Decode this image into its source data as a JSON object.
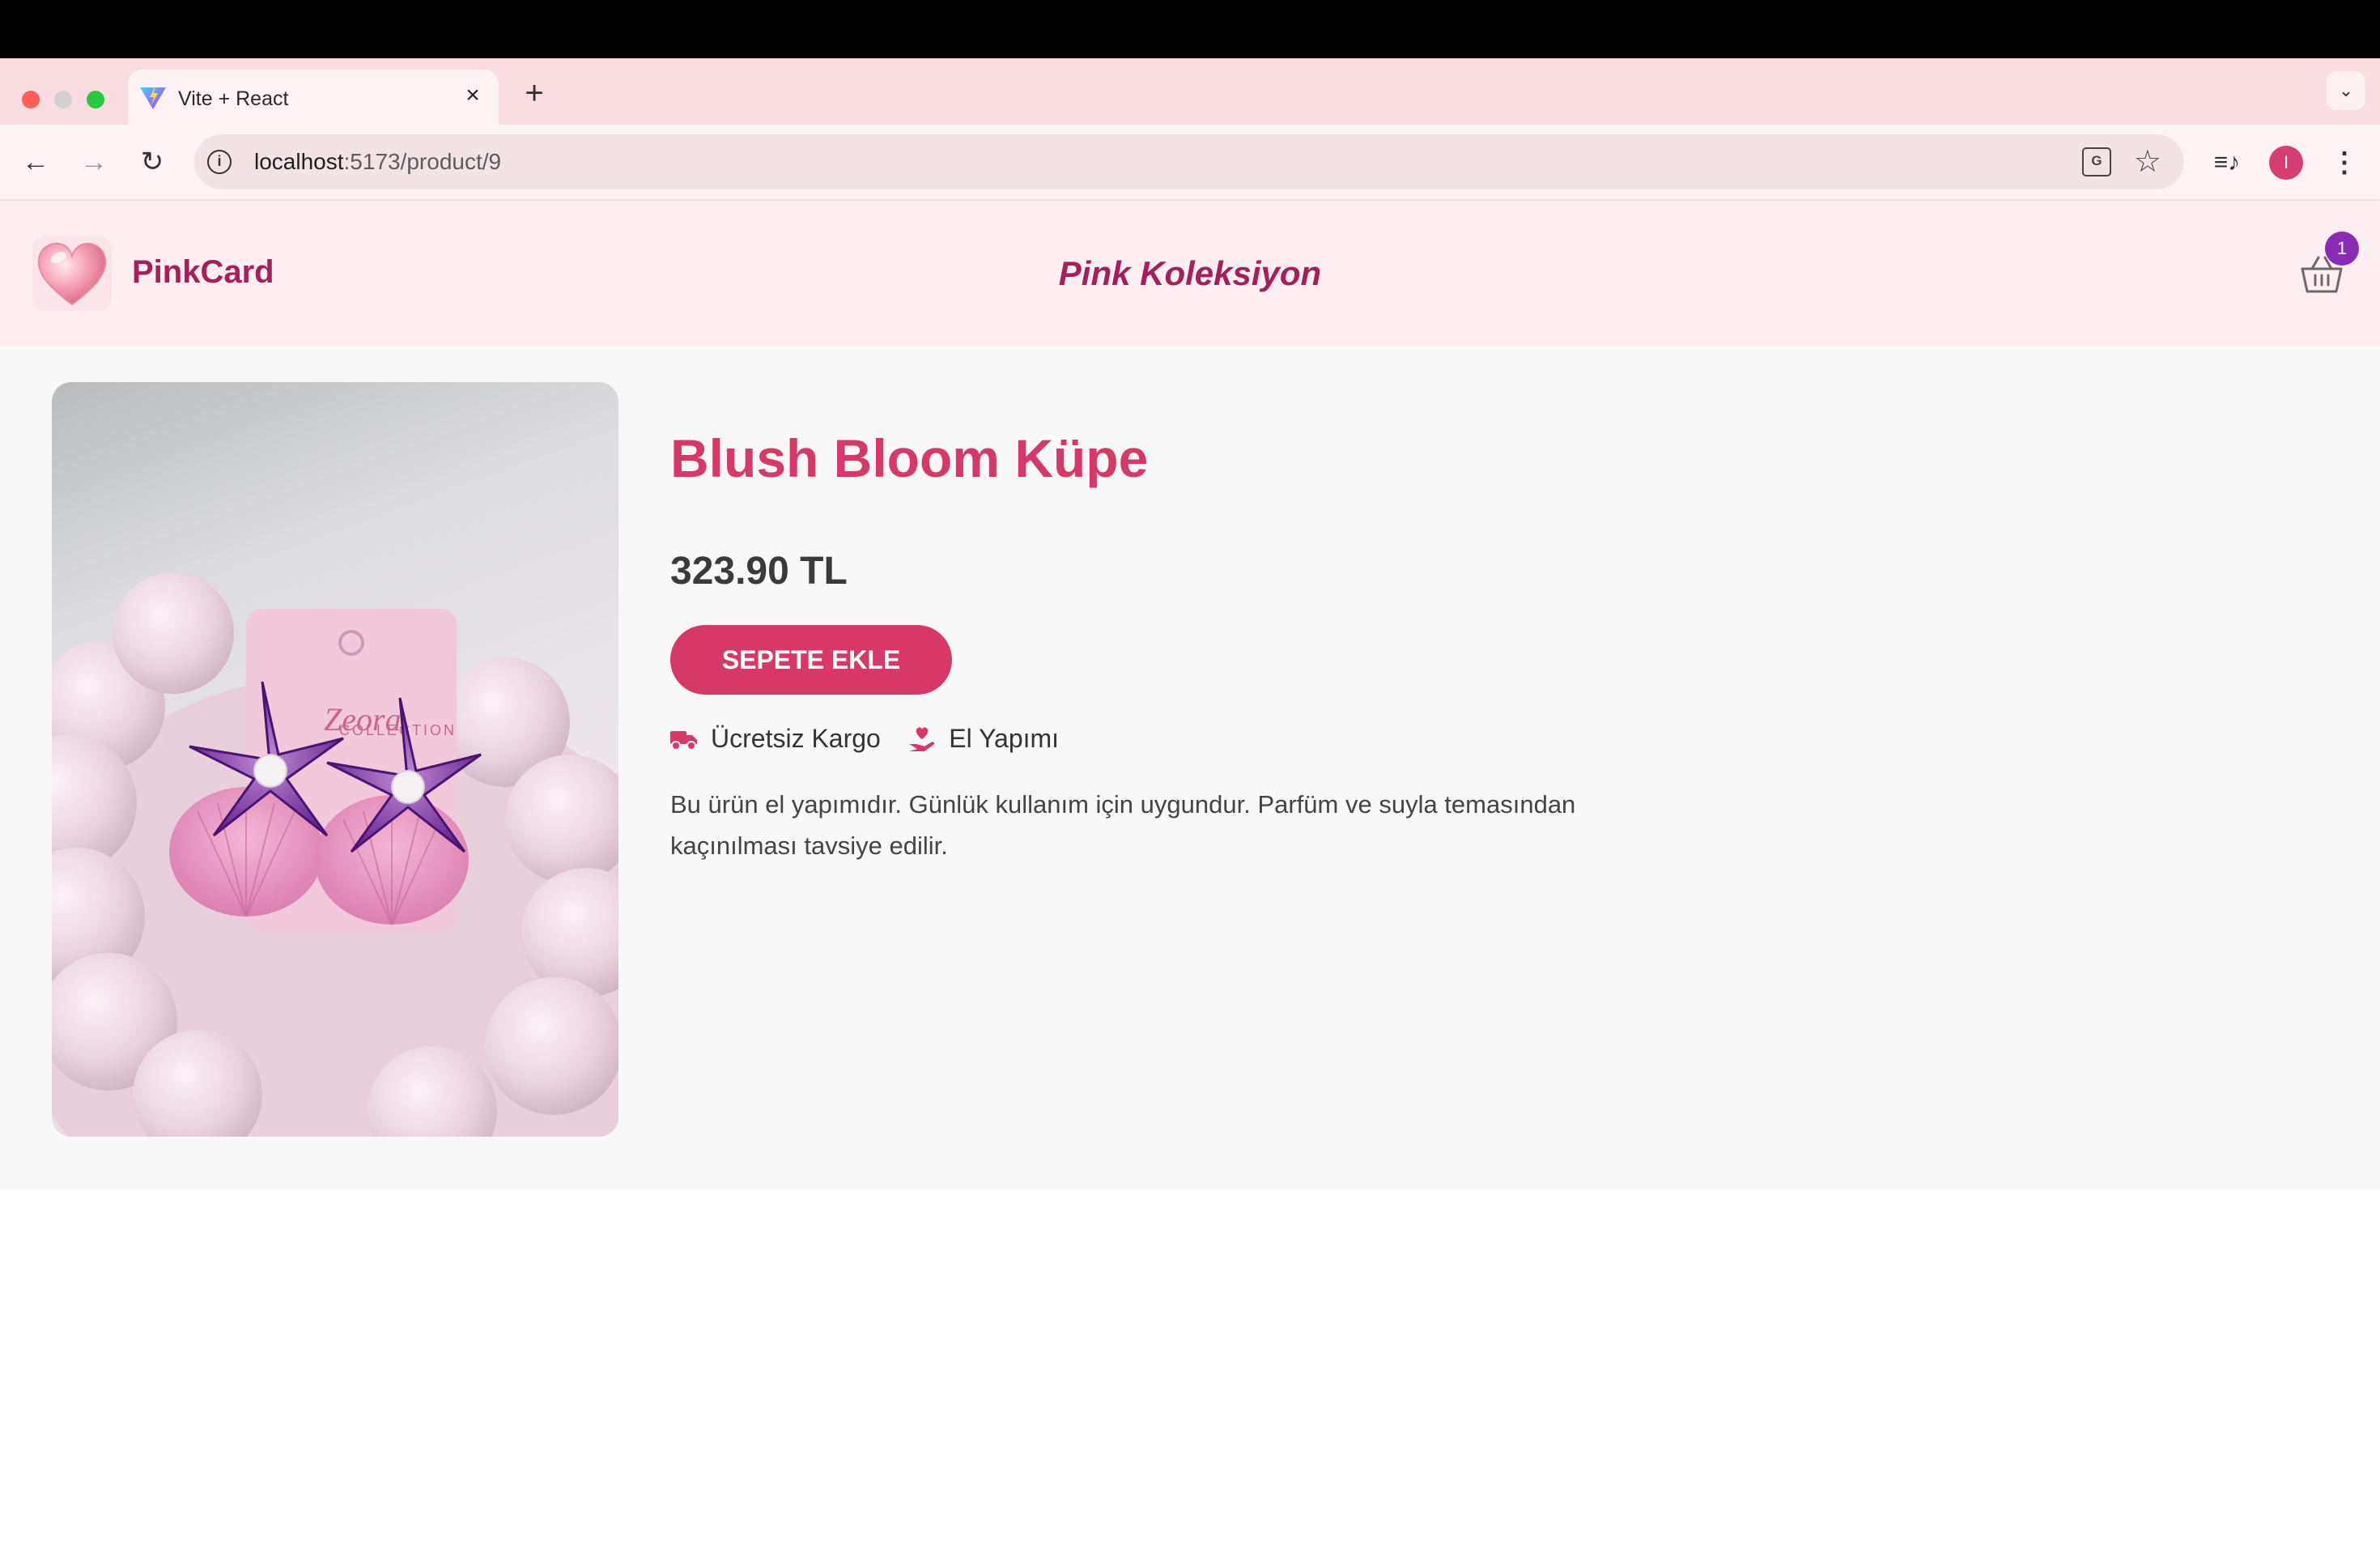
{
  "browser": {
    "tab_title": "Vite + React",
    "url_host": "localhost",
    "url_path": ":5173/product/9",
    "profile_initial": "I"
  },
  "header": {
    "brand_name": "PinkCard",
    "collection_title": "Pink Koleksiyon",
    "cart_count": "1"
  },
  "product": {
    "title": "Blush Bloom Küpe",
    "price": "323.90 TL",
    "add_to_cart_label": "SEPETE EKLE",
    "features": [
      {
        "icon": "truck-icon",
        "label": "Ücretsiz Kargo"
      },
      {
        "icon": "hand-heart-icon",
        "label": "El Yapımı"
      }
    ],
    "description": "Bu ürün el yapımıdır. Günlük kullanım için uygundur. Parfüm ve suyla temasından kaçınılması tavsiye edilir.",
    "image_card_text": "COLLECTION"
  },
  "colors": {
    "accent": "#d63867",
    "brand": "#a3205a",
    "badge": "#8a2bb5",
    "header_bg": "#fdeef2"
  }
}
